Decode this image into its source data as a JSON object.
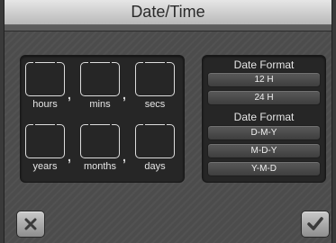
{
  "window": {
    "title": "Date/Time"
  },
  "time_fields": [
    {
      "label": "hours"
    },
    {
      "label": "mins"
    },
    {
      "label": "secs"
    }
  ],
  "date_fields": [
    {
      "label": "years"
    },
    {
      "label": "months"
    },
    {
      "label": "days"
    }
  ],
  "separators": {
    "comma": ","
  },
  "time_format": {
    "heading": "Date Format",
    "options": [
      "12 H",
      "24 H"
    ]
  },
  "date_format": {
    "heading": "Date Format",
    "options": [
      "D-M-Y",
      "M-D-Y",
      "Y-M-D"
    ]
  },
  "actions": {
    "cancel_icon": "close-icon",
    "confirm_icon": "checkmark-icon"
  },
  "colors": {
    "background": "#4c4c4c",
    "panel": "#262626",
    "title_bar": "#d0d0d0",
    "button": "#4a4a4a"
  }
}
